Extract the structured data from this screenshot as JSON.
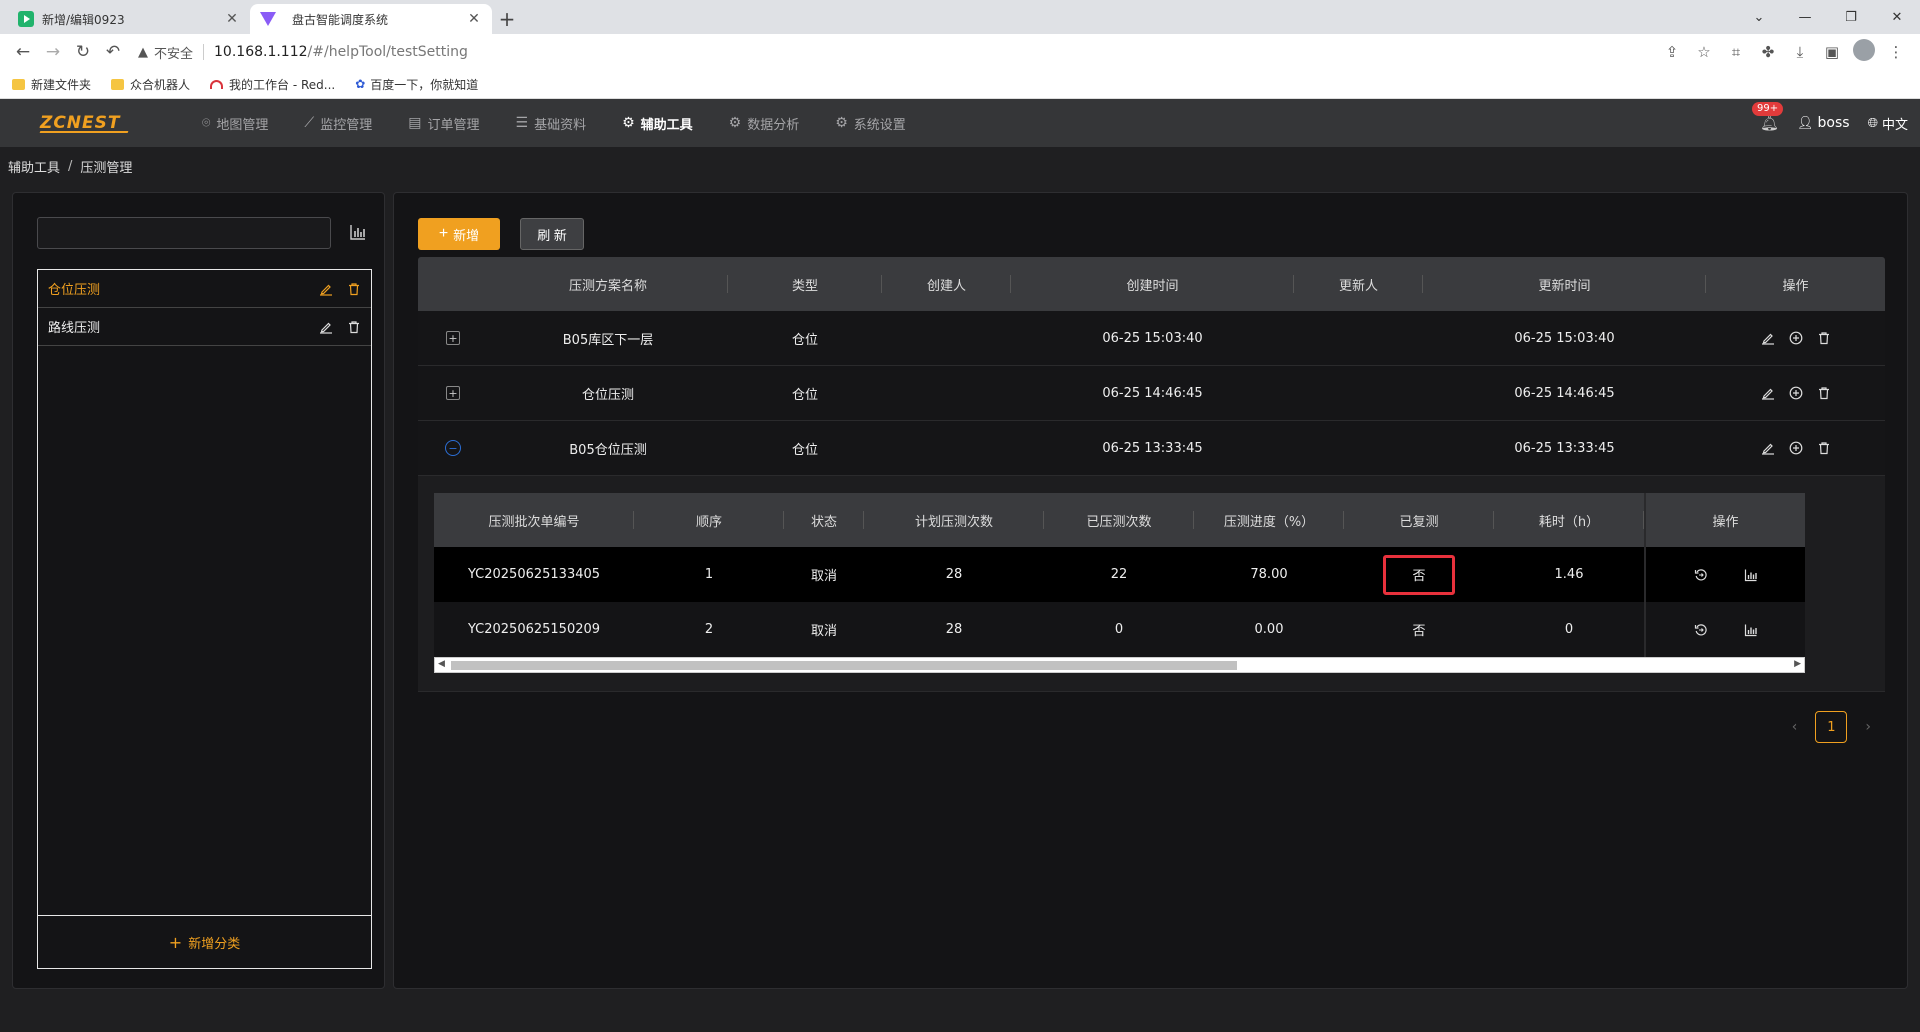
{
  "browser": {
    "tabs": [
      {
        "title": "新增/编辑0923"
      },
      {
        "title": "盘古智能调度系统"
      }
    ],
    "address": {
      "insecure_label": "不安全",
      "host": "10.168.1.112",
      "path": "/#/helpTool/testSetting"
    },
    "bookmarks": [
      {
        "label": "新建文件夹"
      },
      {
        "label": "众合机器人"
      },
      {
        "label": "我的工作台 - Red..."
      },
      {
        "label": "百度一下，你就知道"
      }
    ]
  },
  "app": {
    "logo": "ZCNEST",
    "menu": [
      {
        "label": "地图管理"
      },
      {
        "label": "监控管理"
      },
      {
        "label": "订单管理"
      },
      {
        "label": "基础资料"
      },
      {
        "label": "辅助工具"
      },
      {
        "label": "数据分析"
      },
      {
        "label": "系统设置"
      }
    ],
    "notifications_badge": "99+",
    "user": "boss",
    "language": "中文",
    "accent_color": "#f0a020"
  },
  "breadcrumb": {
    "parent": "辅助工具",
    "current": "压测管理"
  },
  "left_panel": {
    "search_placeholder": "",
    "categories": [
      {
        "label": "仓位压测"
      },
      {
        "label": "路线压测"
      }
    ],
    "add_category": "新增分类"
  },
  "right_panel": {
    "add_button": "新增",
    "refresh_button": "刷 新",
    "columns": [
      "压测方案名称",
      "类型",
      "创建人",
      "创建时间",
      "更新人",
      "更新时间",
      "操作"
    ],
    "rows": [
      {
        "name": "B05库区下一层",
        "type": "仓位",
        "creator": "",
        "created": "06-25 15:03:40",
        "updater": "",
        "updated": "06-25 15:03:40"
      },
      {
        "name": "仓位压测",
        "type": "仓位",
        "creator": "",
        "created": "06-25 14:46:45",
        "updater": "",
        "updated": "06-25 14:46:45"
      },
      {
        "name": "B05仓位压测",
        "type": "仓位",
        "creator": "",
        "created": "06-25 13:33:45",
        "updater": "",
        "updated": "06-25 13:33:45"
      }
    ],
    "sub_table": {
      "columns": [
        "压测批次单编号",
        "顺序",
        "状态",
        "计划压测次数",
        "已压测次数",
        "压测进度（%）",
        "已复测",
        "耗时（h）",
        "操作"
      ],
      "rows": [
        {
          "batch": "YC20250625133405",
          "order": "1",
          "status": "取消",
          "planned": "28",
          "done": "22",
          "progress": "78.00",
          "retested": "否",
          "hours": "1.46"
        },
        {
          "batch": "YC20250625150209",
          "order": "2",
          "status": "取消",
          "planned": "28",
          "done": "0",
          "progress": "0.00",
          "retested": "否",
          "hours": "0"
        }
      ]
    },
    "pagination": {
      "current": "1"
    }
  }
}
